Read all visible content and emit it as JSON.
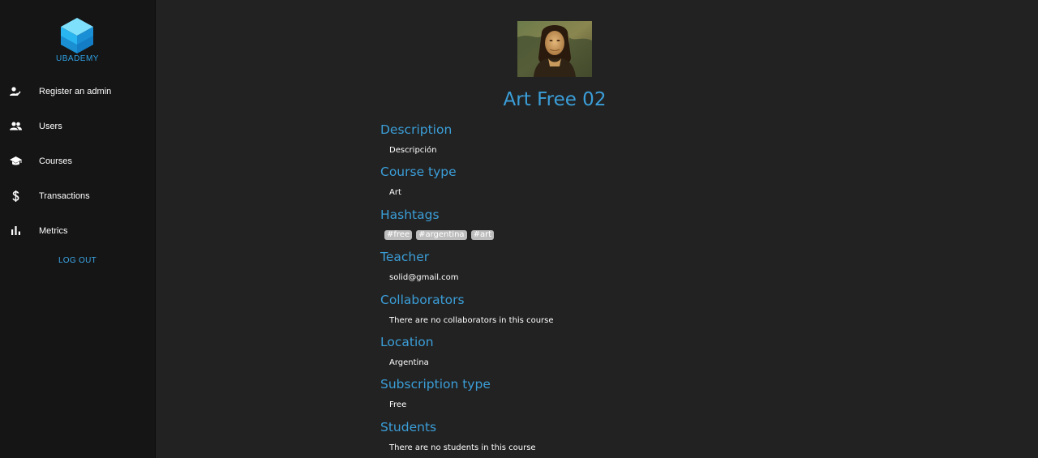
{
  "sidebar": {
    "logo_text": "UBADEMY",
    "items": [
      {
        "label": "Register an admin",
        "icon": "person-check-icon"
      },
      {
        "label": "Users",
        "icon": "people-icon"
      },
      {
        "label": "Courses",
        "icon": "school-icon"
      },
      {
        "label": "Transactions",
        "icon": "dollar-icon"
      },
      {
        "label": "Metrics",
        "icon": "bar-chart-icon"
      }
    ],
    "logout_label": "LOG OUT"
  },
  "course": {
    "image_alt": "Mona Lisa painting",
    "title": "Art Free 02",
    "sections": {
      "description": {
        "title": "Description",
        "value": "Descripción"
      },
      "course_type": {
        "title": "Course type",
        "value": "Art"
      },
      "hashtags": {
        "title": "Hashtags",
        "tags": [
          "#free",
          "#argentina",
          "#art"
        ]
      },
      "teacher": {
        "title": "Teacher",
        "value": "solid@gmail.com"
      },
      "collaborators": {
        "title": "Collaborators",
        "value": "There are no collaborators in this course"
      },
      "location": {
        "title": "Location",
        "value": "Argentina"
      },
      "subscription_type": {
        "title": "Subscription type",
        "value": "Free"
      },
      "students": {
        "title": "Students",
        "value": "There are no students in this course"
      }
    }
  },
  "colors": {
    "accent": "#3b9ed8",
    "sidebar_bg": "#151515",
    "main_bg": "#222222",
    "tag_bg": "#bdbdbd"
  }
}
